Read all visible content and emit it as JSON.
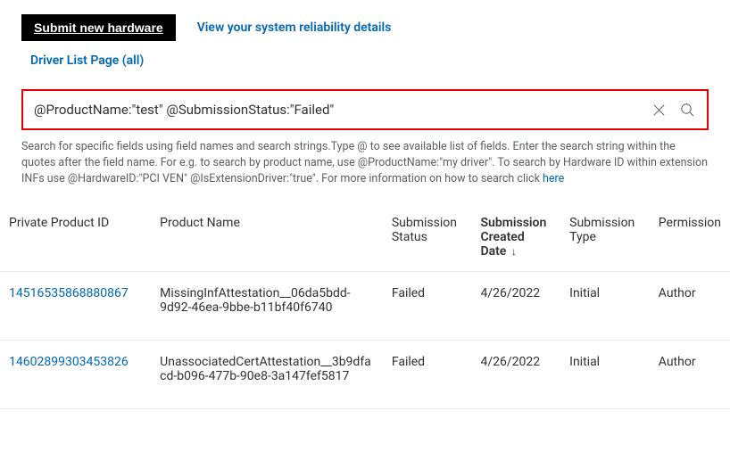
{
  "actions": {
    "submit_label": "Submit new hardware",
    "reliability_label": "View your system reliability details",
    "driver_list_label": "Driver List Page (all)"
  },
  "search": {
    "value": "@ProductName:\"test\" @SubmissionStatus:\"Failed\""
  },
  "help": {
    "line1": "Search for specific fields using field names and search strings.Type @ to see available list of fields. Enter the search string within the quotes after the field name. For e.g. to search by product name, use @ProductName:\"my driver\". To search by Hardware ID within extension INFs use @HardwareID:\"PCI VEN\" @IsExtensionDriver:\"true\". For more information on how to search click ",
    "here": "here"
  },
  "columns": {
    "id": "Private Product ID",
    "name": "Product Name",
    "status": "Submission Status",
    "date": "Submission Created Date",
    "type": "Submission Type",
    "perm": "Permission"
  },
  "sort_indicator": "↓",
  "rows": [
    {
      "id": "14516535868880867",
      "name": "MissingInfAttestation__06da5bdd-9d92-46ea-9bbe-b11bf40f6740",
      "status": "Failed",
      "date": "4/26/2022",
      "type": "Initial",
      "perm": "Author"
    },
    {
      "id": "14602899303453826",
      "name": "UnassociatedCertAttestation__3b9dfacd-b096-477b-90e8-3a147fef5817",
      "status": "Failed",
      "date": "4/26/2022",
      "type": "Initial",
      "perm": "Author"
    }
  ]
}
